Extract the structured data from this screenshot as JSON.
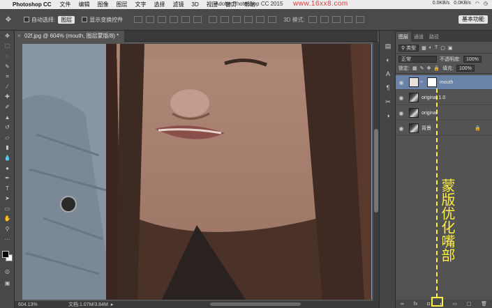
{
  "menubar": {
    "app_name": "Photoshop CC",
    "items": [
      "文件",
      "编辑",
      "图像",
      "图层",
      "文字",
      "选择",
      "滤镜",
      "3D",
      "视图",
      "窗口",
      "帮助"
    ],
    "window_title": "Adobe Photoshop CC 2015",
    "watermark": "www.16xx8.com",
    "status": [
      "0.0KB/s",
      "0.0KB/s"
    ]
  },
  "options_bar": {
    "auto_select_label": "自动选择:",
    "auto_select_value": "图层",
    "show_transform_label": "显示变换控件",
    "mode_3d_label": "3D 模式:",
    "workspace": "基本功能"
  },
  "document": {
    "tab_title": "02f.jpg @ 604% (mouth, 图层蒙版/8) *",
    "zoom": "604.13%",
    "doc_info": "文档:1.07M/3.84M"
  },
  "layers_panel": {
    "tabs": [
      "图层",
      "通道",
      "路径"
    ],
    "kind_filter": "类型",
    "blend_mode": "正常",
    "opacity_label": "不透明度:",
    "opacity_value": "100%",
    "lock_label": "锁定:",
    "fill_label": "填充:",
    "fill_value": "100%",
    "layers": [
      {
        "name": "mouth",
        "selected": true,
        "has_mask": true
      },
      {
        "name": "original 1.0",
        "selected": false,
        "has_mask": false
      },
      {
        "name": "original",
        "selected": false,
        "has_mask": false
      },
      {
        "name": "背景",
        "selected": false,
        "has_mask": false,
        "locked": true
      }
    ]
  },
  "annotation": {
    "text": "蒙版优化嘴部",
    "color": "#ffee44"
  },
  "colors": {
    "selected_layer": "#6a82a8",
    "panel_bg": "#535353"
  }
}
